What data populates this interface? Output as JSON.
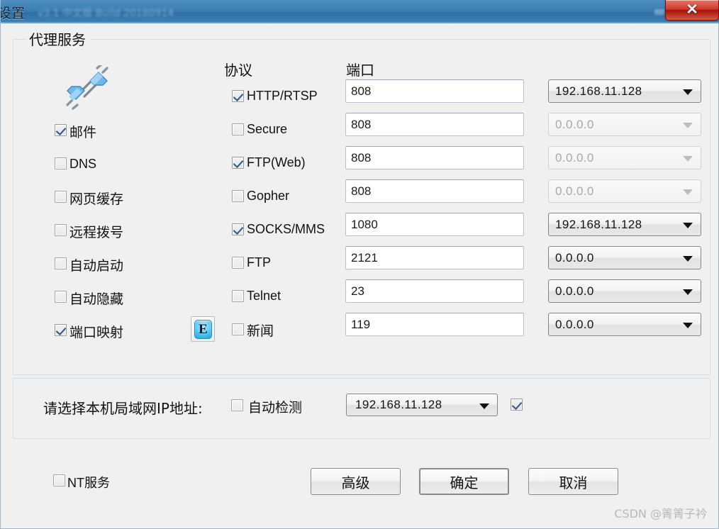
{
  "window": {
    "title": "设置",
    "title_sub": "v3.1 中文版 Build 20180914",
    "close_label": "✕"
  },
  "proxy_group": {
    "title": "代理服务",
    "plug_icon": "plug-connector-icon",
    "left_options": [
      {
        "label": "邮件",
        "checked": true,
        "type": "cjk"
      },
      {
        "label": "DNS",
        "checked": false,
        "type": "latin"
      },
      {
        "label": "网页缓存",
        "checked": false,
        "type": "cjk"
      },
      {
        "label": "远程拨号",
        "checked": false,
        "type": "cjk"
      },
      {
        "label": "自动启动",
        "checked": false,
        "type": "cjk"
      },
      {
        "label": "自动隐藏",
        "checked": false,
        "type": "cjk"
      },
      {
        "label": "端口映射",
        "checked": true,
        "type": "cjk"
      }
    ],
    "e_button_label": "E",
    "headers": {
      "protocol": "协议",
      "port": "端口"
    },
    "rows": [
      {
        "protocol": "HTTP/RTSP",
        "protocol_type": "latin",
        "checked": true,
        "port": "808",
        "ip": "192.168.11.128",
        "ip_enabled": true
      },
      {
        "protocol": "Secure",
        "protocol_type": "latin",
        "checked": false,
        "port": "808",
        "ip": "0.0.0.0",
        "ip_enabled": false
      },
      {
        "protocol": "FTP(Web)",
        "protocol_type": "latin",
        "checked": true,
        "port": "808",
        "ip": "0.0.0.0",
        "ip_enabled": false
      },
      {
        "protocol": "Gopher",
        "protocol_type": "latin",
        "checked": false,
        "port": "808",
        "ip": "0.0.0.0",
        "ip_enabled": false
      },
      {
        "protocol": "SOCKS/MMS",
        "protocol_type": "latin",
        "checked": true,
        "port": "1080",
        "ip": "192.168.11.128",
        "ip_enabled": true
      },
      {
        "protocol": "FTP",
        "protocol_type": "latin",
        "checked": false,
        "port": "2121",
        "ip": "0.0.0.0",
        "ip_enabled": true
      },
      {
        "protocol": "Telnet",
        "protocol_type": "latin",
        "checked": false,
        "port": "23",
        "ip": "0.0.0.0",
        "ip_enabled": true
      },
      {
        "protocol": "新闻",
        "protocol_type": "cjk",
        "checked": false,
        "port": "119",
        "ip": "0.0.0.0",
        "ip_enabled": true
      }
    ]
  },
  "ip_group": {
    "label": "请选择本机局域网IP地址:",
    "auto_detect_label": "自动检测",
    "auto_detect_checked": false,
    "selected_ip": "192.168.11.128",
    "trailing_checked": true
  },
  "footer": {
    "nt_service_label": "NT服务",
    "nt_service_checked": false,
    "advanced_label": "高级",
    "ok_label": "确定",
    "cancel_label": "取消"
  },
  "watermark": "CSDN @箐箐子衿"
}
